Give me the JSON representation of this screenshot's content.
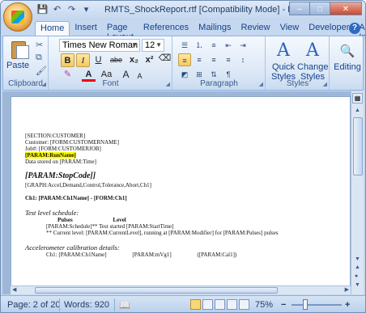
{
  "window": {
    "title": "RMTS_ShockReport.rtf [Compatibility Mode] - Micro...",
    "controls": {
      "minimize": "–",
      "maximize": "□",
      "close": "✕"
    }
  },
  "quick_access": {
    "save_icon": "save-icon",
    "undo_icon": "undo-icon",
    "redo_icon": "redo-icon",
    "customize_icon": "customize-icon"
  },
  "tabs": [
    "Home",
    "Insert",
    "Page Layout",
    "References",
    "Mailings",
    "Review",
    "View",
    "Developer",
    "Add-Ins"
  ],
  "active_tab": "Home",
  "ribbon": {
    "clipboard": {
      "label": "Clipboard",
      "paste": "Paste"
    },
    "font": {
      "label": "Font",
      "font_name": "Times New Roman",
      "font_size": "12",
      "bold": "B",
      "italic": "I",
      "underline": "U",
      "strike": "abe",
      "subscript": "x₂",
      "superscript": "x²",
      "change_case": "Aa",
      "grow": "A",
      "shrink": "A"
    },
    "paragraph": {
      "label": "Paragraph"
    },
    "styles": {
      "label": "Styles",
      "quick_styles": "Quick Styles",
      "change_styles": "Change Styles"
    },
    "editing": {
      "label": "Editing"
    }
  },
  "document": {
    "lines": {
      "section": "[SECTION:CUSTOMER]",
      "customer": "Customer: [FORM:CUSTOMERNAME]",
      "job": "Job#: [FORM:CUSTOMERJOB]",
      "runname": "[PARAM:RunName]",
      "datastored": "Data stored on [PARAM:Time]",
      "stopcode": "[PARAM:StopCode]]",
      "graph": "[GRAPH:Accel,Demand,Control,Tolerance,Abort,Ch1]",
      "ch1": "Ch1: [PARAM:Ch1Name]  - [FORM:Ch1]",
      "schedule": "Test level schedule:",
      "col_pulses": "Pulses",
      "col_level": "Level",
      "schedule_row": "[PARAM:Schedule]** Test started [PARAM:StartTime]",
      "current_row": "** Current level: [PARAM:CurrentLevel],  running at [PARAM:Modifier] for [PARAM:Pulses] pulses",
      "accel": "Accelerometer calibration details:",
      "cal_name": "Ch1: [PARAM:Ch1Name]",
      "cal_mvg": "[PARAM:mVg1]",
      "cal_cal": "([PARAM:Cal1])"
    }
  },
  "status_bar": {
    "page": "Page: 2 of 20",
    "words": "Words: 920",
    "zoom": "75%",
    "zoom_out": "−",
    "zoom_in": "+"
  }
}
